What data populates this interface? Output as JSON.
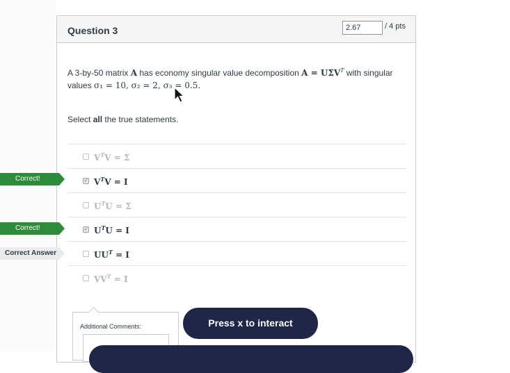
{
  "question": {
    "title": "Question 3",
    "score_value": "2.67",
    "points_suffix": "/ 4 pts",
    "text_prefix": "A 3-by-50 matrix ",
    "matrix_symbol": "A",
    "text_mid": " has economy singular value decomposition ",
    "svd_expr": "A = UΣV",
    "svd_sup": "T",
    "text_suffix": " with singular values ",
    "sigma_values": "σ₁ = 10, σ₂ = 2, σ₃ = 0.5.",
    "instruction_prefix": "Select ",
    "instruction_bold": "all",
    "instruction_suffix": " the true statements."
  },
  "answers": [
    {
      "base": "V",
      "sup": "T",
      "rest": "V = Σ",
      "checked": false,
      "faded": true,
      "tag": ""
    },
    {
      "base": "V",
      "sup": "T",
      "rest": "V = I",
      "checked": true,
      "faded": false,
      "tag": "Correct!"
    },
    {
      "base": "U",
      "sup": "T",
      "rest": "U = Σ",
      "checked": false,
      "faded": true,
      "tag": ""
    },
    {
      "base": "U",
      "sup": "T",
      "rest": "U = I",
      "checked": true,
      "faded": false,
      "tag": "Correct!"
    },
    {
      "base": "UU",
      "sup": "T",
      "rest": " = I",
      "checked": false,
      "faded": false,
      "tag": "Correct Answer"
    },
    {
      "base": "VV",
      "sup": "T",
      "rest": " = I",
      "checked": false,
      "faded": true,
      "tag": ""
    }
  ],
  "comments": {
    "label": "Additional Comments:"
  },
  "overlay": {
    "interact_label": "Press x to interact"
  },
  "colors": {
    "correct": "#2e8b3a",
    "button_dark": "#1e2747"
  }
}
